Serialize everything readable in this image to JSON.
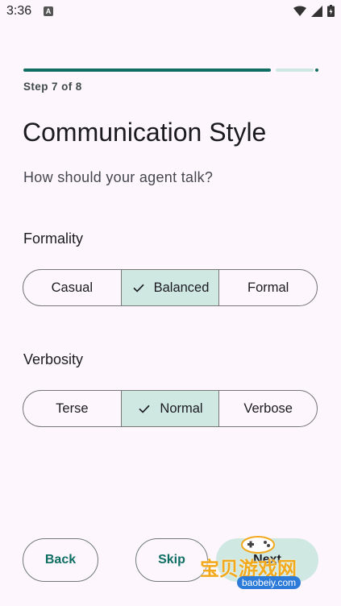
{
  "status_bar": {
    "time": "3:36",
    "notification_icon": "A"
  },
  "progress": {
    "step_label": "Step 7 of 8",
    "value_fraction": 0.875
  },
  "header": {
    "title": "Communication Style",
    "subtitle": "How should your agent talk?"
  },
  "formality": {
    "label": "Formality",
    "options": [
      "Casual",
      "Balanced",
      "Formal"
    ],
    "selected": "Balanced"
  },
  "verbosity": {
    "label": "Verbosity",
    "options": [
      "Terse",
      "Normal",
      "Verbose"
    ],
    "selected": "Normal"
  },
  "footer": {
    "back_label": "Back",
    "skip_label": "Skip",
    "next_label": "Next"
  },
  "watermark": {
    "text": "宝贝游戏网",
    "url": "baobeiy.com"
  },
  "colors": {
    "accent": "#0F6E63",
    "selected_bg": "#CFE8E2",
    "background": "#FDF7FD"
  }
}
